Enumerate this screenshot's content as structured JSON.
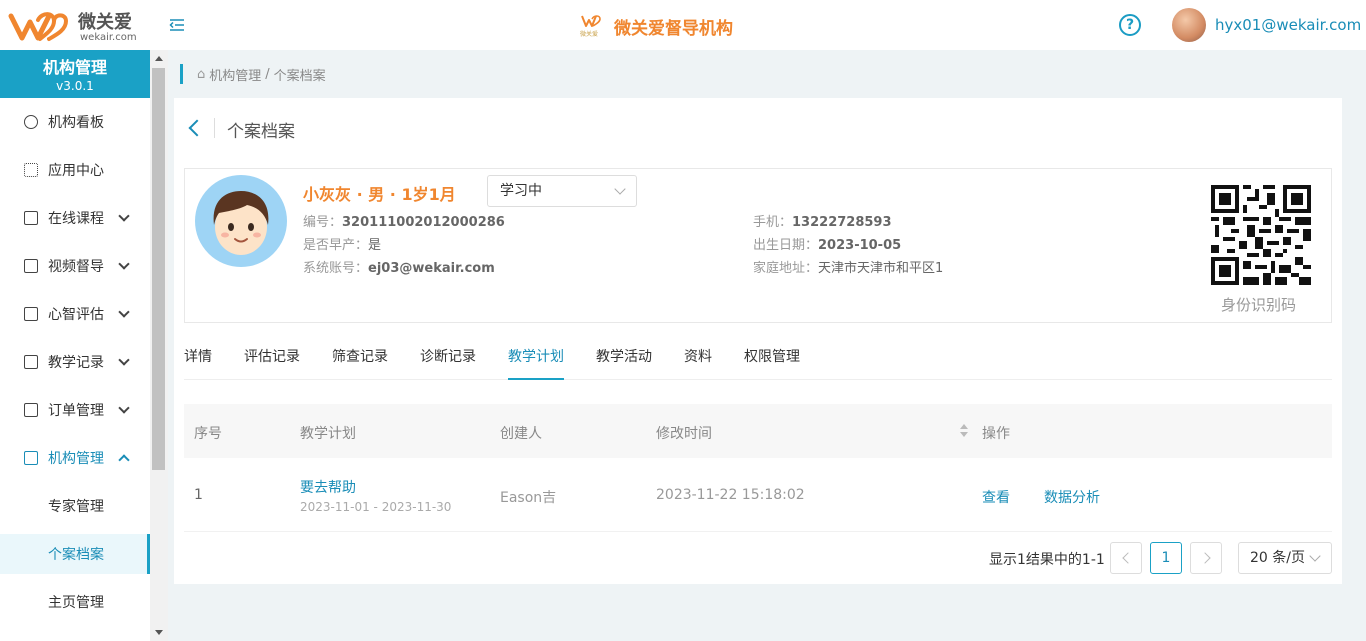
{
  "header": {
    "logo_name": "微关爱",
    "logo_domain": "wekair.com",
    "center_logo_small": "微关爱",
    "center_title": "微关爱督导机构",
    "user_email": "hyx01@wekair.com",
    "help_symbol": "?"
  },
  "sidebar": {
    "title": "机构管理",
    "version": "v3.0.1",
    "items": [
      {
        "label": "机构看板",
        "icon": "pie-chart-icon"
      },
      {
        "label": "应用中心",
        "icon": "grid-icon"
      },
      {
        "label": "在线课程",
        "icon": "book-icon"
      },
      {
        "label": "视频督导",
        "icon": "play-icon"
      },
      {
        "label": "心智评估",
        "icon": "clipboard-icon"
      },
      {
        "label": "教学记录",
        "icon": "video-icon"
      },
      {
        "label": "订单管理",
        "icon": "document-icon"
      },
      {
        "label": "机构管理",
        "icon": "bank-icon"
      }
    ],
    "subitems": [
      {
        "label": "专家管理"
      },
      {
        "label": "个案档案"
      },
      {
        "label": "主页管理"
      }
    ]
  },
  "breadcrumb": {
    "parent": "机构管理",
    "separator": "/",
    "current": "个案档案"
  },
  "card": {
    "title": "个案档案"
  },
  "profile": {
    "name_line": "小灰灰 · 男 · 1岁1月",
    "status": "学习中",
    "id_label": "编号：",
    "id_value": "320111002012000286",
    "premature_label": "是否早产：",
    "premature_value": "是",
    "account_label": "系统账号：",
    "account_value": "ej03@wekair.com",
    "phone_label": "手机：",
    "phone_value": "13222728593",
    "birth_label": "出生日期：",
    "birth_value": "2023-10-05",
    "address_label": "家庭地址：",
    "address_value": "天津市天津市和平区1",
    "qr_label": "身份识别码"
  },
  "tabs": [
    {
      "label": "详情"
    },
    {
      "label": "评估记录"
    },
    {
      "label": "筛查记录"
    },
    {
      "label": "诊断记录"
    },
    {
      "label": "教学计划"
    },
    {
      "label": "教学活动"
    },
    {
      "label": "资料"
    },
    {
      "label": "权限管理"
    }
  ],
  "table": {
    "columns": [
      "序号",
      "教学计划",
      "创建人",
      "修改时间",
      "操作"
    ],
    "rows": [
      {
        "index": "1",
        "plan": "要去帮助",
        "period": "2023-11-01 - 2023-11-30",
        "creator": "Eason吉",
        "modified": "2023-11-22 15:18:02",
        "action_view": "查看",
        "action_analysis": "数据分析"
      }
    ]
  },
  "pagination": {
    "info": "显示1结果中的1-1",
    "current_page": "1",
    "page_size": "20 条/页"
  },
  "colors": {
    "primary": "#1aa1c6",
    "accent_orange": "#f0862f"
  }
}
